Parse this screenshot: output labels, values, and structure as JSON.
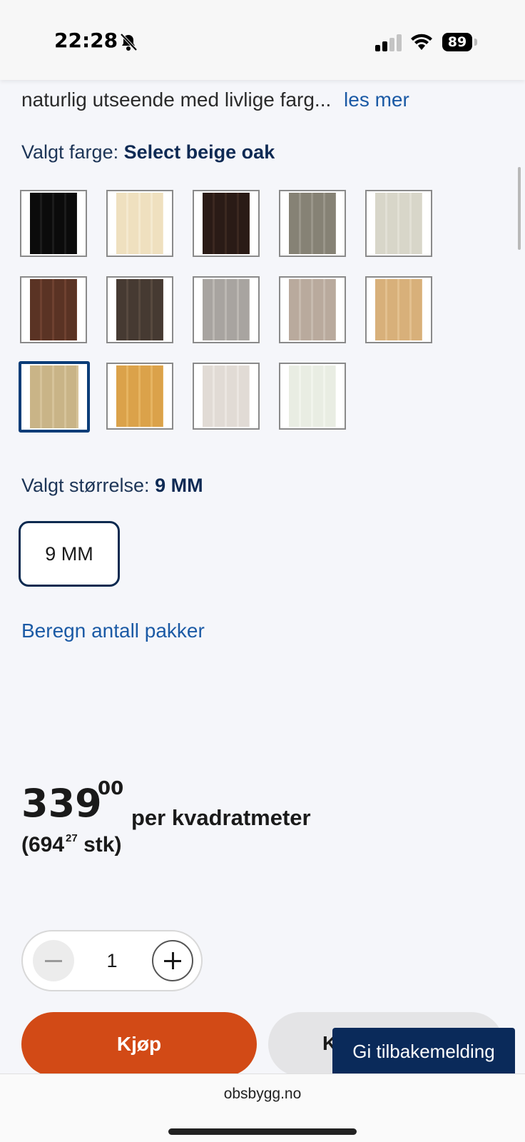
{
  "status_bar": {
    "time": "22:28",
    "battery": "89",
    "icons": [
      "bell-slash-icon",
      "signal-icon",
      "wifi-icon",
      "battery-icon"
    ]
  },
  "product": {
    "description_snippet": "naturlig utseende med livlige farg...",
    "read_more": "les mer",
    "color_label": "Valgt farge:",
    "selected_color": "Select beige oak",
    "swatches": [
      {
        "color": "#0b0b0b",
        "stripe": "#1c1c1c"
      },
      {
        "color": "#efe0bf",
        "stripe": "#f4e9cf"
      },
      {
        "color": "#2a1b16",
        "stripe": "#3b2820"
      },
      {
        "color": "#868275",
        "stripe": "#9a968a"
      },
      {
        "color": "#d8d6c9",
        "stripe": "#e2e0d5"
      },
      {
        "color": "#5a3324",
        "stripe": "#6e4130"
      },
      {
        "color": "#463a32",
        "stripe": "#57493f"
      },
      {
        "color": "#a8a4a0",
        "stripe": "#bcb8b3"
      },
      {
        "color": "#b9aa9d",
        "stripe": "#c7bbaf"
      },
      {
        "color": "#d8b07a",
        "stripe": "#e3c08f"
      },
      {
        "color": "#c9b487",
        "stripe": "#d6c39a",
        "selected": true
      },
      {
        "color": "#dba24a",
        "stripe": "#e6b461"
      },
      {
        "color": "#e1dbd5",
        "stripe": "#ebe6e1"
      },
      {
        "color": "#e9ede3",
        "stripe": "#f1f4ec"
      }
    ],
    "size_label": "Valgt størrelse:",
    "selected_size": "9 MM",
    "size_options": [
      "9 MM"
    ],
    "calc_link": "Beregn antall pakker",
    "price_main": "339",
    "price_cents": "00",
    "price_unit": "per kvadratmeter",
    "price_piece_open": "(694",
    "price_piece_cents": "27",
    "price_piece_close": "stk)",
    "quantity": "1",
    "buy_label": "Kjøp",
    "secondary_label": "K",
    "feedback_label": "Gi tilbakemelding"
  },
  "browser": {
    "url": "obsbygg.no"
  },
  "colors": {
    "accent": "#d24a16",
    "brand_navy": "#0a2a5a",
    "link": "#1b5aa5"
  }
}
